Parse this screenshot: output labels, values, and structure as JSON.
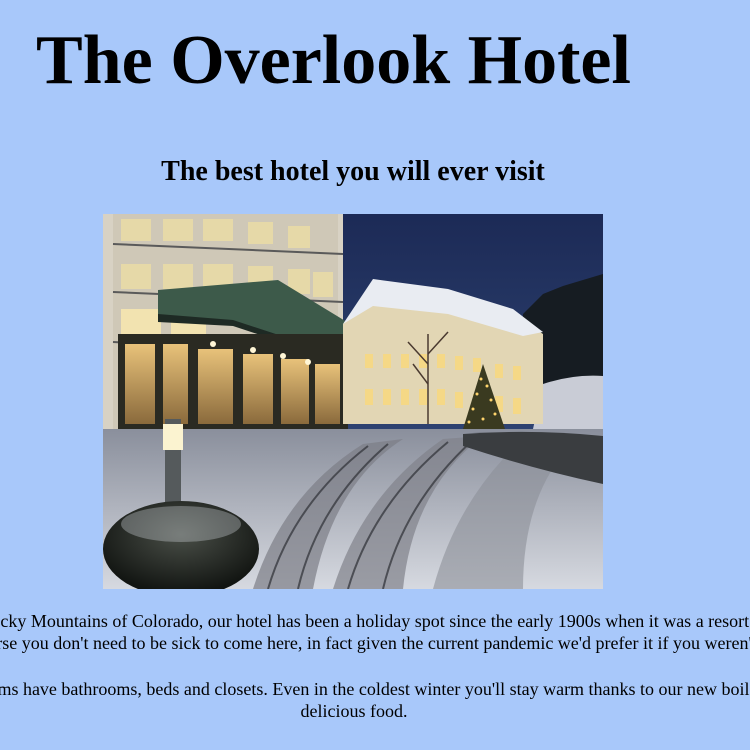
{
  "page": {
    "title": "The Overlook Hotel",
    "subtitle": "The best hotel you will ever visit",
    "paragraphs": [
      {
        "lines": [
          "Situated in the Rocky Mountains of Colorado, our hotel has been a holiday spot since the early 1900s when it was a resort destination.",
          "Of course you don't need to be sick to come here, in fact given the current pandemic we'd prefer it if you weren't."
        ]
      },
      {
        "lines": [
          "Our rooms have bathrooms, beds and closets. Even in the coldest winter you'll stay warm thanks to our new boiler.",
          "delicious food."
        ]
      }
    ]
  },
  "colors": {
    "background": "#a8c8fa",
    "text": "#000000"
  }
}
